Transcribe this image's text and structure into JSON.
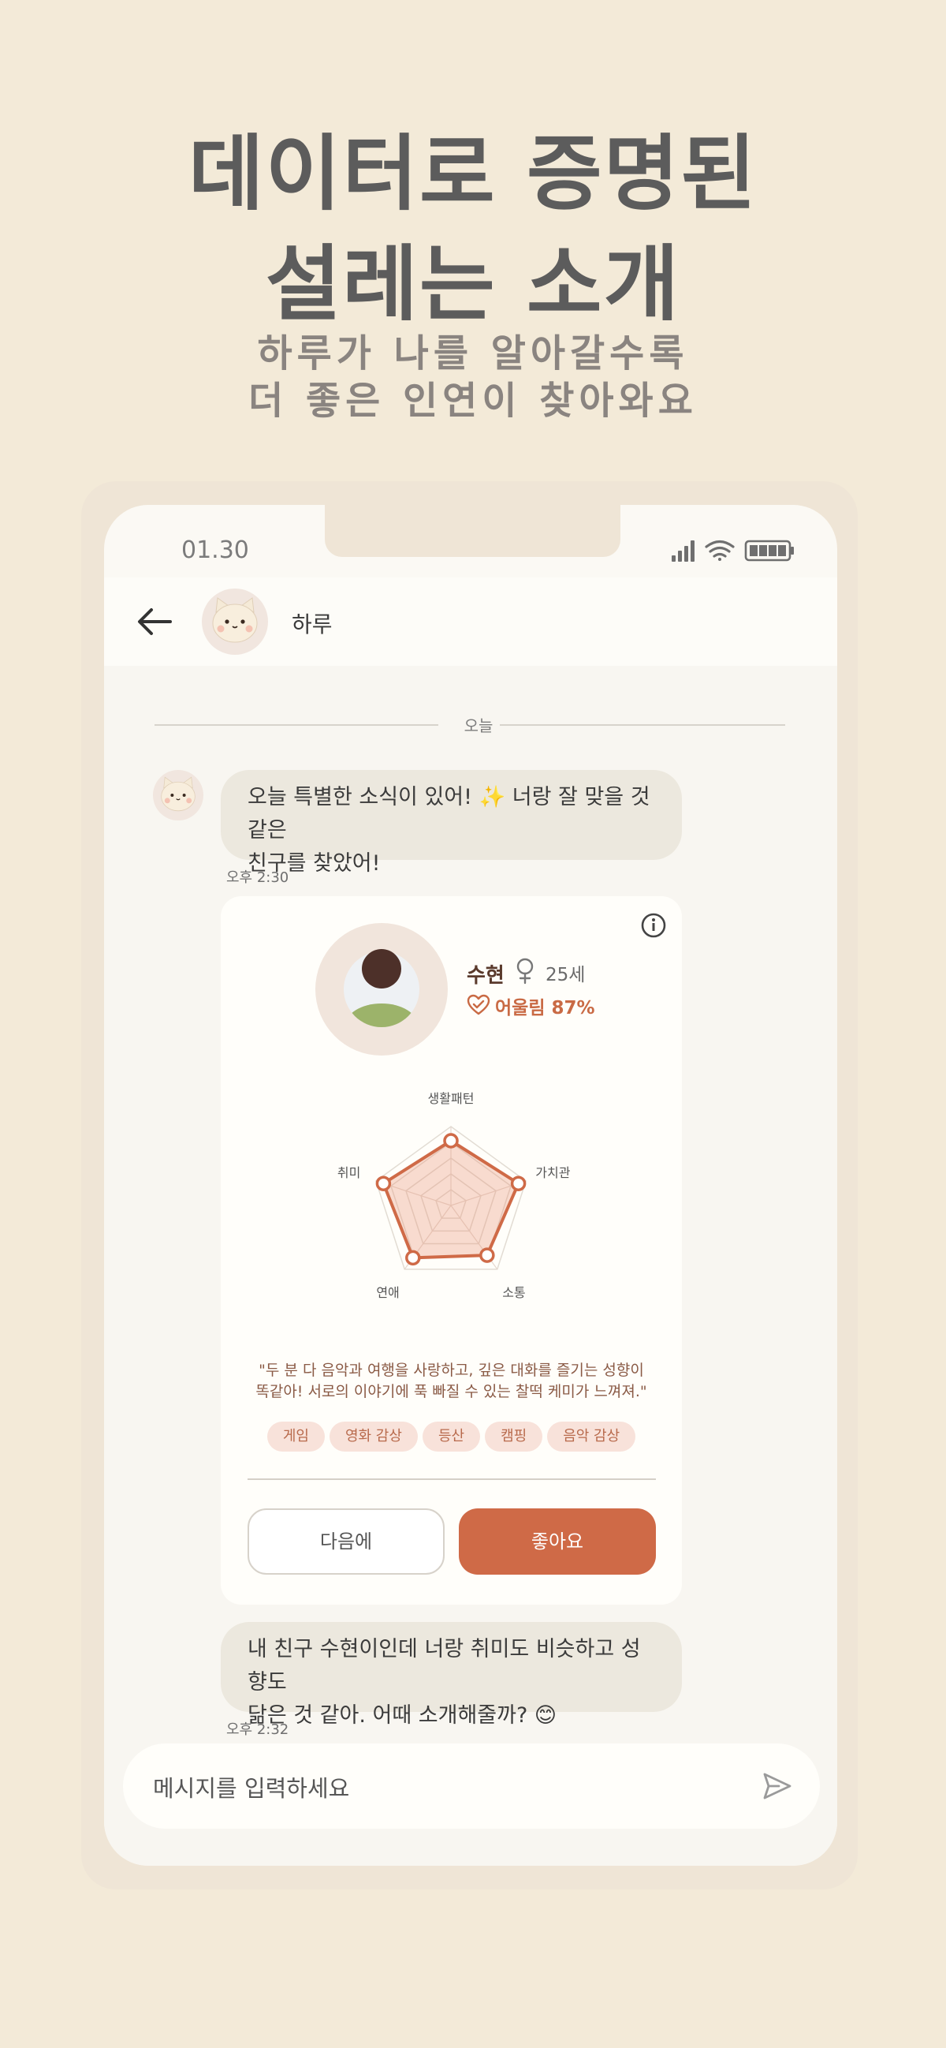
{
  "promo": {
    "title_line1": "데이터로 증명된",
    "title_line2": "설레는 소개",
    "subtitle_line1": "하루가 나를 알아갈수록",
    "subtitle_line2": "더 좋은 인연이 찾아와요"
  },
  "status_bar": {
    "time": "01.30"
  },
  "chat_header": {
    "name": "하루"
  },
  "date_divider": "오늘",
  "messages": [
    {
      "line1": "오늘 특별한 소식이 있어! ✨ 너랑 잘 맞을 것 같은",
      "line2": "친구를 찾았어!",
      "time": "오후 2:30"
    },
    {
      "line1": "내 친구 수현이인데 너랑 취미도 비슷하고 성향도",
      "line2": "닮은 것 같아. 어때 소개해줄까? 😊",
      "time": "오후 2:32"
    }
  ],
  "match_card": {
    "name": "수현",
    "age": "25세",
    "match_text": "어울림 87%",
    "match_percent": 87,
    "quote_line1": "\"두 분 다 음악과 여행을 사랑하고, 깊은 대화를 즐기는 성향이",
    "quote_line2": "똑같아! 서로의 이야기에 푹 빠질 수 있는 찰떡 케미가 느껴져.\"",
    "tags": [
      "게임",
      "영화 감상",
      "등산",
      "캠핑",
      "음악 감상"
    ],
    "btn_next": "다음에",
    "btn_like": "좋아요"
  },
  "radar_chart": {
    "axes": [
      "생활패턴",
      "가치관",
      "소통",
      "연애",
      "취미"
    ],
    "values": [
      0.82,
      0.9,
      0.78,
      0.82,
      0.9
    ],
    "max": 1
  },
  "input": {
    "placeholder": "메시지를 입력하세요"
  },
  "colors": {
    "accent": "#cf6a47",
    "background": "#f3ead8",
    "bubble": "#ece8de"
  }
}
